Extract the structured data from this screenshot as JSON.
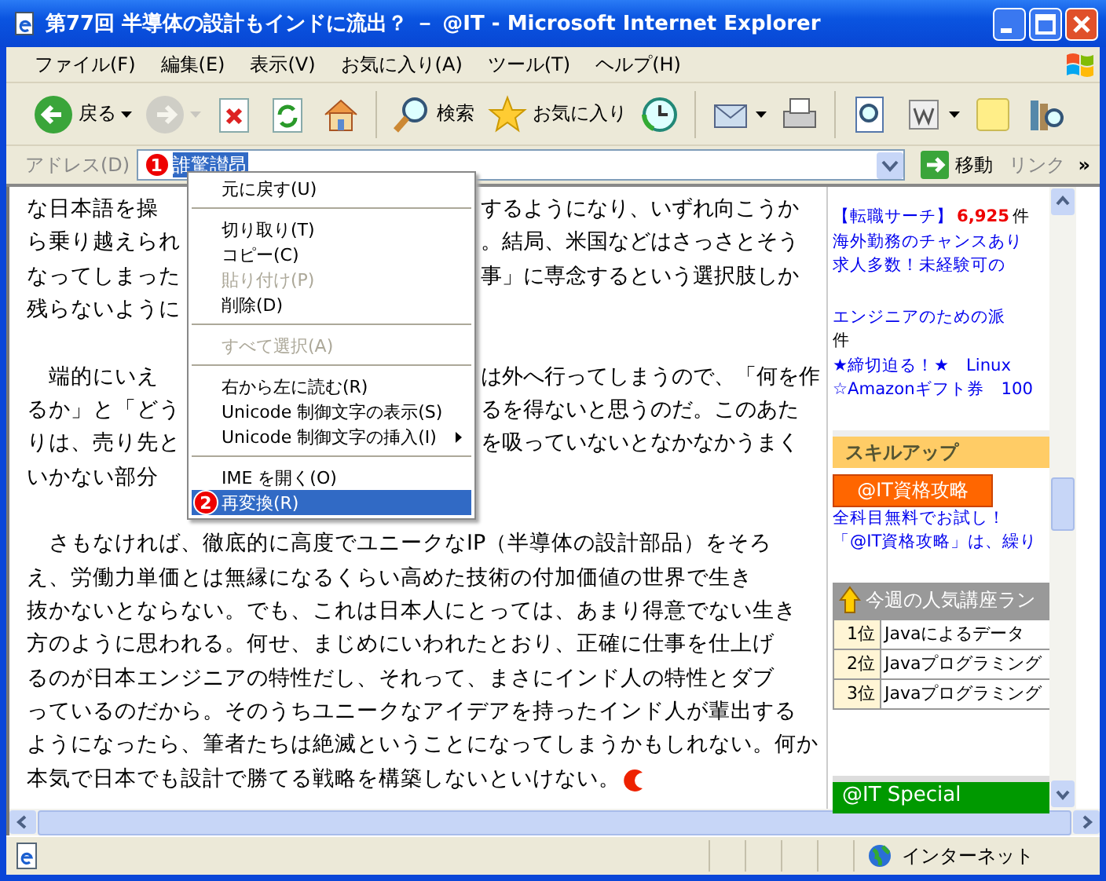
{
  "window": {
    "title": "第77回 半導体の設計もインドに流出？ － @IT - Microsoft Internet Explorer"
  },
  "menu_bar": [
    "ファイル(F)",
    "編集(E)",
    "表示(V)",
    "お気に入り(A)",
    "ツール(T)",
    "ヘルプ(H)"
  ],
  "toolbar": [
    {
      "kind": "back",
      "label": "戻る",
      "dropdown": true,
      "disabled": false
    },
    {
      "kind": "forward",
      "dropdown": true,
      "disabled": true
    },
    {
      "kind": "stop",
      "dropdown": false,
      "disabled": false
    },
    {
      "kind": "refresh",
      "dropdown": false,
      "disabled": false
    },
    {
      "kind": "home",
      "dropdown": false,
      "disabled": false
    },
    {
      "kind": "separator"
    },
    {
      "kind": "search",
      "label": "検索",
      "dropdown": false,
      "disabled": false
    },
    {
      "kind": "favorites",
      "label": "お気に入り",
      "dropdown": false,
      "disabled": false
    },
    {
      "kind": "history",
      "dropdown": false,
      "disabled": false
    },
    {
      "kind": "separator"
    },
    {
      "kind": "mail",
      "dropdown": true,
      "disabled": false
    },
    {
      "kind": "print",
      "dropdown": false,
      "disabled": false
    },
    {
      "kind": "separator"
    },
    {
      "kind": "preview",
      "dropdown": false,
      "disabled": false
    },
    {
      "kind": "word",
      "dropdown": true,
      "disabled": false
    },
    {
      "kind": "notes",
      "dropdown": false,
      "disabled": false
    },
    {
      "kind": "research",
      "dropdown": false,
      "disabled": false
    }
  ],
  "address_bar": {
    "label": "アドレス(D)",
    "callout": "1",
    "value": "誰驚讃昂",
    "go": "移動",
    "links": "リンク",
    "more": "»"
  },
  "context_menu": [
    {
      "kind": "item",
      "label": "元に戻す(U)",
      "disabled": false,
      "selected": false,
      "submenu": false
    },
    {
      "kind": "separator"
    },
    {
      "kind": "item",
      "label": "切り取り(T)",
      "disabled": false,
      "selected": false,
      "submenu": false
    },
    {
      "kind": "item",
      "label": "コピー(C)",
      "disabled": false,
      "selected": false,
      "submenu": false
    },
    {
      "kind": "item",
      "label": "貼り付け(P)",
      "disabled": true,
      "selected": false,
      "submenu": false
    },
    {
      "kind": "item",
      "label": "削除(D)",
      "disabled": false,
      "selected": false,
      "submenu": false
    },
    {
      "kind": "separator"
    },
    {
      "kind": "item",
      "label": "すべて選択(A)",
      "disabled": true,
      "selected": false,
      "submenu": false
    },
    {
      "kind": "separator"
    },
    {
      "kind": "item",
      "label": "右から左に読む(R)",
      "disabled": false,
      "selected": false,
      "submenu": false
    },
    {
      "kind": "item",
      "label": "Unicode 制御文字の表示(S)",
      "disabled": false,
      "selected": false,
      "submenu": false
    },
    {
      "kind": "item",
      "label": "Unicode 制御文字の挿入(I)",
      "disabled": false,
      "selected": false,
      "submenu": true
    },
    {
      "kind": "separator"
    },
    {
      "kind": "item",
      "label": "IME を開く(O)",
      "disabled": false,
      "selected": false,
      "submenu": false
    },
    {
      "kind": "item",
      "label": "再変換(R)",
      "disabled": false,
      "selected": true,
      "submenu": false,
      "callout": "2"
    }
  ],
  "article": [
    {
      "lines": [
        {
          "left": "な日本語を操",
          "right": "するようになり、いずれ向こうか"
        },
        {
          "left": "ら乗り越えられ",
          "right": "。結局、米国などはさっさとそう"
        },
        {
          "left": "なってしまった",
          "right": "事」に専念するという選択肢しか"
        },
        {
          "left": "残らないように"
        }
      ]
    },
    {
      "lines": [
        {
          "left": "　端的にいえ",
          "right": "は外へ行ってしまうので、「何を作"
        },
        {
          "left": "るか」と「どう",
          "right": "るを得ないと思うのだ。このあた"
        },
        {
          "left": "りは、売り先と",
          "right": "を吸っていないとなかなかうまく"
        },
        {
          "left": "いかない部分"
        }
      ]
    },
    {
      "lines": [
        {
          "text": "　さもなければ、徹底的に高度でユニークなIP（半導体の設計部品）をそろ"
        },
        {
          "text": "え、労働力単価とは無縁になるくらい高めた技術の付加価値の世界で生き"
        },
        {
          "text": "抜かないとならない。でも、これは日本人にとっては、あまり得意でない生き"
        },
        {
          "text": "方のように思われる。何せ、まじめにいわれたとおり、正確に仕事を仕上げ"
        },
        {
          "text": "るのが日本エンジニアの特性だし、それって、まさにインド人の特性とダブ"
        },
        {
          "text": "っているのだから。そのうちユニークなアイデアを持ったインド人が輩出する"
        },
        {
          "text": "ようになったら、筆者たちは絶滅ということになってしまうかもしれない。何か"
        },
        {
          "text": "本気で日本でも設計で勝てる戦略を構築しないといけない。"
        }
      ]
    }
  ],
  "sidebar": [
    {
      "kind": "ad",
      "lines": [
        [
          {
            "kind": "link",
            "text": "【転職サーチ】"
          },
          {
            "kind": "count",
            "text": "6,925"
          },
          {
            "kind": "plain",
            "text": "件"
          }
        ],
        [
          {
            "kind": "link",
            "text": "海外勤務のチャンスあり"
          }
        ],
        [
          {
            "kind": "link",
            "text": "求人多数！未経験可の"
          }
        ]
      ]
    },
    {
      "kind": "ad",
      "lines": [
        [
          {
            "kind": "link",
            "text": "エンジニアのための派"
          }
        ],
        [
          {
            "kind": "plain",
            "text": "件"
          }
        ],
        [
          {
            "kind": "link",
            "text": "★締切迫る！★　Linux"
          }
        ],
        [
          {
            "kind": "link",
            "text": "☆Amazonギフト券　100"
          }
        ]
      ]
    },
    {
      "kind": "header",
      "text": "スキルアップ"
    },
    {
      "kind": "button",
      "text": "@IT資格攻略"
    },
    {
      "kind": "ad",
      "lines": [
        [
          {
            "kind": "link",
            "text": "全科目無料でお試し！"
          }
        ],
        [
          {
            "kind": "link",
            "text": "「@IT資格攻略」は、繰り"
          }
        ]
      ]
    },
    {
      "kind": "ranking",
      "title": "今週の人気講座ラン",
      "rows": [
        [
          "1位",
          "Javaによるデータ"
        ],
        [
          "2位",
          "Javaプログラミング"
        ],
        [
          "3位",
          "Javaプログラミング"
        ]
      ]
    },
    {
      "kind": "special",
      "text": "@IT Special"
    }
  ],
  "status_bar": {
    "zone": "インターネット"
  }
}
